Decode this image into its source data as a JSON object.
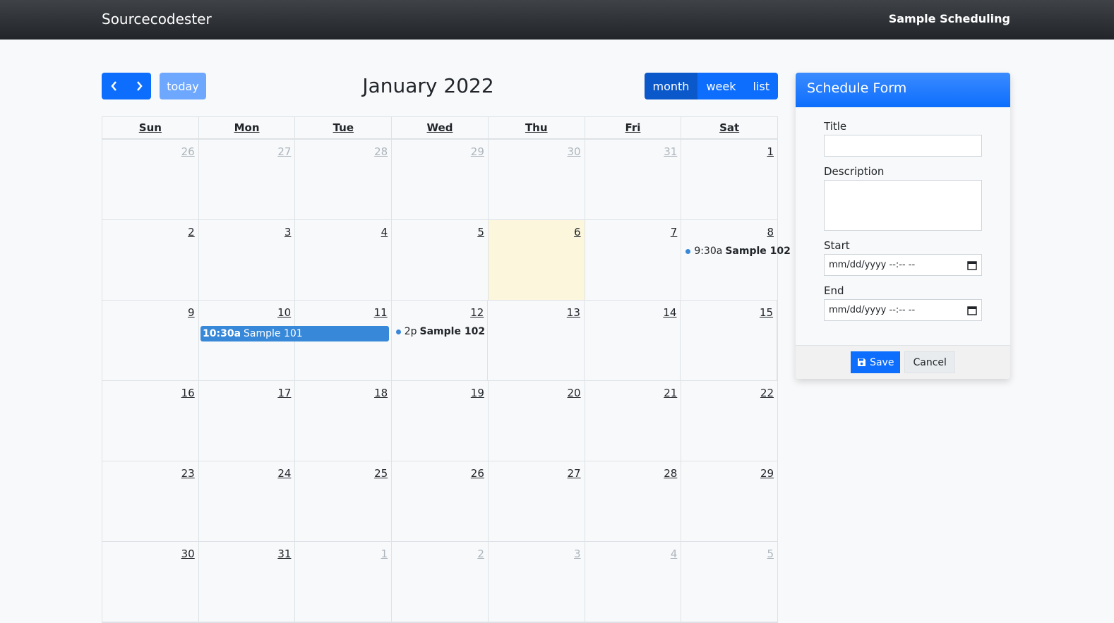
{
  "navbar": {
    "brand": "Sourcecodester",
    "right_title": "Sample Scheduling"
  },
  "toolbar": {
    "prev_icon": "chevron-left-icon",
    "next_icon": "chevron-right-icon",
    "today_label": "today",
    "title": "January 2022",
    "views": [
      "month",
      "week",
      "list"
    ],
    "active_view": "month"
  },
  "calendar": {
    "dow": [
      "Sun",
      "Mon",
      "Tue",
      "Wed",
      "Thu",
      "Fri",
      "Sat"
    ],
    "weeks": [
      [
        "26",
        "27",
        "28",
        "29",
        "30",
        "31",
        "1"
      ],
      [
        "2",
        "3",
        "4",
        "5",
        "6",
        "7",
        "8"
      ],
      [
        "9",
        "10",
        "11",
        "12",
        "13",
        "14",
        "15"
      ],
      [
        "16",
        "17",
        "18",
        "19",
        "20",
        "21",
        "22"
      ],
      [
        "23",
        "24",
        "25",
        "26",
        "27",
        "28",
        "29"
      ],
      [
        "30",
        "31",
        "1",
        "2",
        "3",
        "4",
        "5"
      ]
    ],
    "events": [
      {
        "time": "9:30a",
        "title": "Sample 102",
        "day": "8"
      },
      {
        "time": "10:30a",
        "title": "Sample 101",
        "days": [
          "10",
          "11"
        ]
      },
      {
        "time": "2p",
        "title": "Sample 102",
        "day": "12"
      }
    ],
    "today": "6",
    "event_color": "#3788d8",
    "today_color": "#fbf6dc"
  },
  "form": {
    "header": "Schedule Form",
    "title_label": "Title",
    "title_value": "",
    "description_label": "Description",
    "description_value": "",
    "start_label": "Start",
    "start_placeholder": "mm/dd/yyyy --:-- --",
    "end_label": "End",
    "end_placeholder": "mm/dd/yyyy --:-- --",
    "save_label": "Save",
    "save_icon": "floppy-disk-icon",
    "cancel_label": "Cancel",
    "calendar_icon": "calendar-icon"
  }
}
